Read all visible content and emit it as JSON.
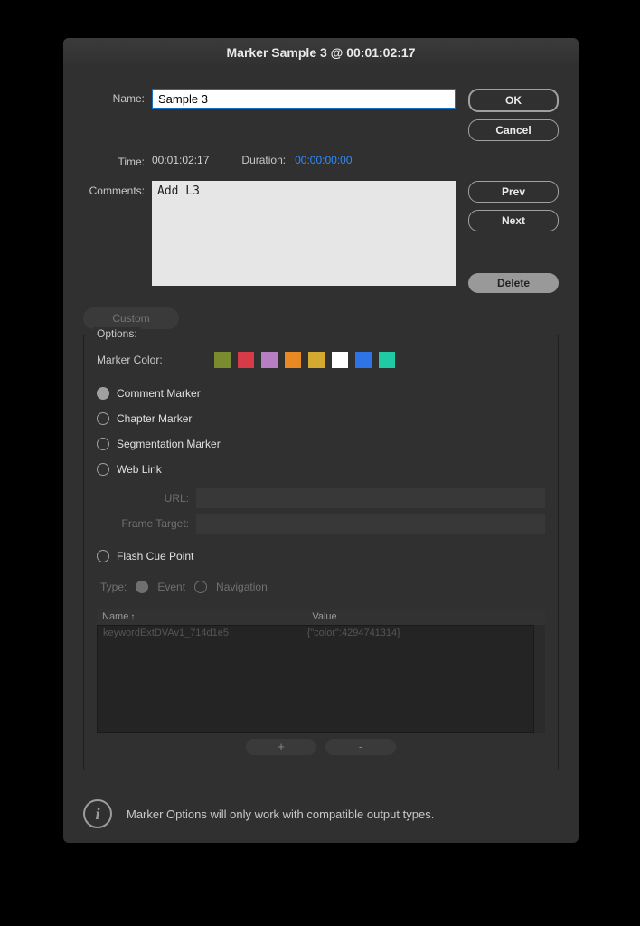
{
  "title": "Marker Sample 3 @ 00:01:02:17",
  "labels": {
    "name": "Name:",
    "time": "Time:",
    "duration": "Duration:",
    "comments": "Comments:",
    "custom": "Custom",
    "options": "Options:",
    "marker_color": "Marker Color:",
    "url": "URL:",
    "frame_target": "Frame Target:",
    "type": "Type:",
    "col_name": "Name",
    "col_value": "Value"
  },
  "fields": {
    "name_value": "Sample 3",
    "time_value": "00:01:02:17",
    "duration_value": "00:00:00:00",
    "comments_value": "Add L3"
  },
  "buttons": {
    "ok": "OK",
    "cancel": "Cancel",
    "prev": "Prev",
    "next": "Next",
    "delete": "Delete",
    "plus": "+",
    "minus": "-"
  },
  "marker_types": {
    "comment": "Comment Marker",
    "chapter": "Chapter Marker",
    "segmentation": "Segmentation Marker",
    "weblink": "Web Link",
    "flash": "Flash Cue Point"
  },
  "flash_types": {
    "event": "Event",
    "navigation": "Navigation"
  },
  "swatches": [
    "#7a8b2f",
    "#d73b48",
    "#b77ec4",
    "#e88923",
    "#d5a92f",
    "#ffffff",
    "#2e74e6",
    "#1fc9a3"
  ],
  "cue_table": {
    "row_name": "keywordExtDVAv1_714d1e5",
    "row_value": "{\"color\":4294741314}"
  },
  "info_text": "Marker Options will only work with compatible output types."
}
